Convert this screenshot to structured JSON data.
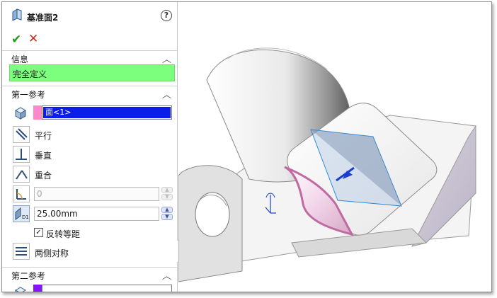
{
  "feature": {
    "title": "基准面2",
    "help_label": "?",
    "ok_label": "✔",
    "cancel_label": "✕"
  },
  "info_section": {
    "header": "信息",
    "status": "完全定义",
    "status_color": "#7cff7c"
  },
  "first_reference": {
    "header": "第一参考",
    "selection": "面<1>",
    "flag_color": "#ff88c8",
    "options": [
      {
        "label": "平行"
      },
      {
        "label": "垂直"
      },
      {
        "label": "重合"
      }
    ],
    "angle_value": "0",
    "distance_value": "25.00mm",
    "flip_label": "反转等距",
    "flip_checked": true,
    "symmetric_label": "两侧对称"
  },
  "second_reference": {
    "header": "第二参考",
    "flag_color": "#8a12ff"
  },
  "colors": {
    "selection_highlight": "#0a1ee8",
    "plane_edge": "#2f8ad8",
    "face_highlight": "#c06aa0"
  }
}
